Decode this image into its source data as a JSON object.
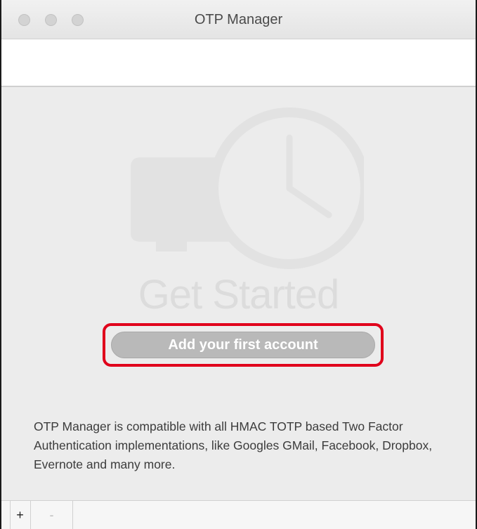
{
  "window": {
    "title": "OTP Manager"
  },
  "empty_state": {
    "heading": "Get Started",
    "add_button_label": "Add your first account",
    "info_text": "OTP Manager is compatible with all HMAC TOTP based Two Factor Authentication implementations, like Googles GMail, Facebook, Dropbox, Evernote and many more."
  },
  "bottom_bar": {
    "add_label": "+",
    "remove_label": "-"
  },
  "icons": {
    "illustration": "card-with-clock-icon"
  },
  "colors": {
    "highlight": "#e0001b",
    "button": "#b9b9b9",
    "illustration": "#e2e2e2"
  }
}
